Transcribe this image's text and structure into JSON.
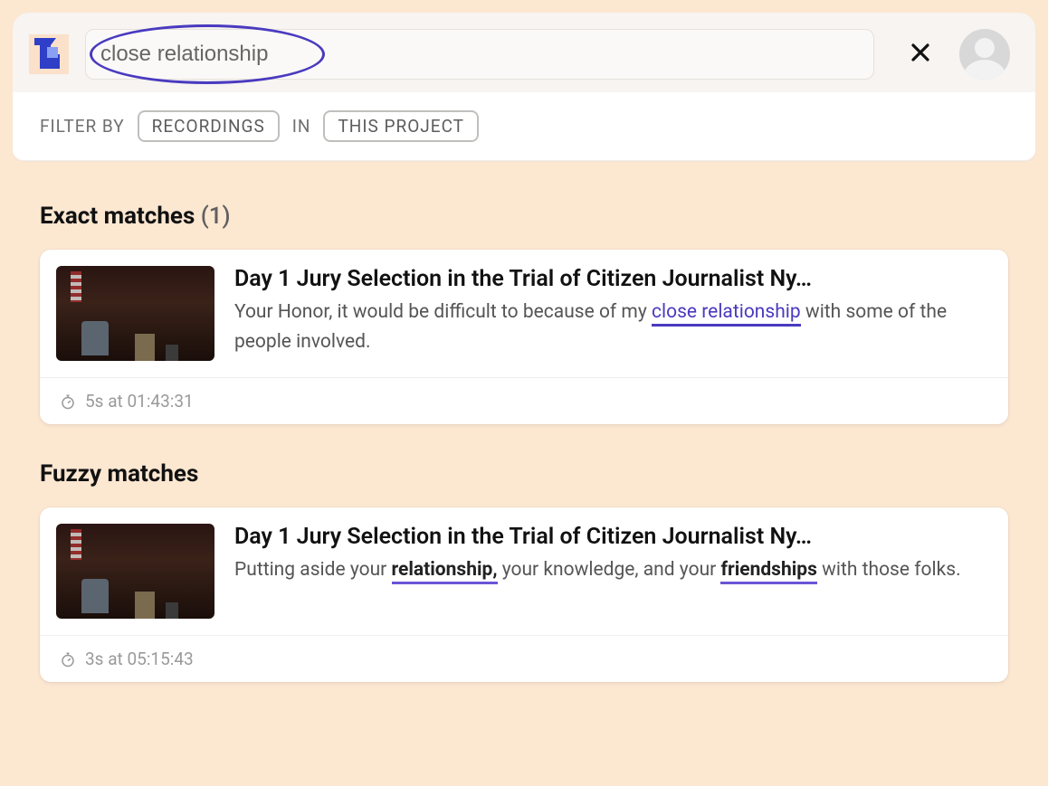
{
  "search": {
    "query": "close relationship"
  },
  "filter": {
    "label": "FILTER BY",
    "type_chip": "RECORDINGS",
    "in_label": "IN",
    "scope_chip": "THIS PROJECT"
  },
  "sections": {
    "exact": {
      "title": "Exact matches",
      "count": "(1)"
    },
    "fuzzy": {
      "title": "Fuzzy matches"
    }
  },
  "results": {
    "exact": [
      {
        "title": "Day 1 Jury Selection in the Trial of Citizen Journalist Ny…",
        "snippet_pre": "Your Honor, it would be difficult to because of my ",
        "snippet_hl": "close relationship",
        "snippet_post": " with some of the people involved.",
        "footer": "5s at 01:43:31"
      }
    ],
    "fuzzy": [
      {
        "title": "Day 1 Jury Selection in the Trial of Citizen Journalist Ny…",
        "snippet_pre": "Putting aside your ",
        "snippet_hl1": "relationship,",
        "snippet_mid": " your knowledge, and your ",
        "snippet_hl2": "friendships",
        "snippet_post": " with those folks.",
        "footer": "3s at 05:15:43"
      }
    ]
  }
}
